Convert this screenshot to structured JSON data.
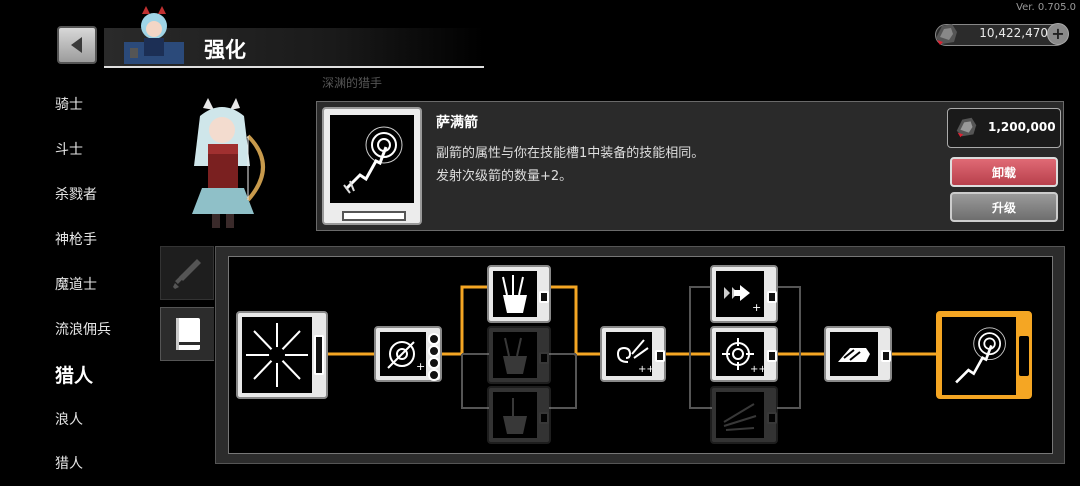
{
  "version": "Ver. 0.705.0",
  "header": {
    "title": "强化"
  },
  "currency": {
    "value": "10,422,470"
  },
  "sidebar": {
    "items": [
      {
        "label": "骑士"
      },
      {
        "label": "斗士"
      },
      {
        "label": "杀戮者"
      },
      {
        "label": "神枪手"
      },
      {
        "label": "魔道士"
      },
      {
        "label": "流浪佣兵"
      },
      {
        "label": "猎人",
        "active": true
      },
      {
        "label": "浪人"
      },
      {
        "label": "猎人"
      }
    ]
  },
  "character": {
    "caption": "深渊的猎手"
  },
  "detail": {
    "name": "萨满箭",
    "desc_line1": "副箭的属性与你在技能槽1中装备的技能相同。",
    "desc_line2": "发射次级箭的数量+2。",
    "cost": "1,200,000",
    "unequip_label": "卸载",
    "upgrade_label": "升级"
  },
  "tree": {
    "accent_color": "#f5a623",
    "nodes": [
      {
        "name": "radial-arrows",
        "state": "active"
      },
      {
        "name": "target-plus",
        "state": "active"
      },
      {
        "name": "quiver",
        "state": "active"
      },
      {
        "name": "quiver-alt",
        "state": "locked"
      },
      {
        "name": "quiver-alt2",
        "state": "locked"
      },
      {
        "name": "spiral-arrows",
        "state": "active"
      },
      {
        "name": "arrow-dash",
        "state": "active"
      },
      {
        "name": "crosshair-plus",
        "state": "active"
      },
      {
        "name": "scatter-arrows",
        "state": "locked"
      },
      {
        "name": "speed-dash",
        "state": "active"
      },
      {
        "name": "shaman-arrow",
        "state": "selected"
      }
    ]
  }
}
